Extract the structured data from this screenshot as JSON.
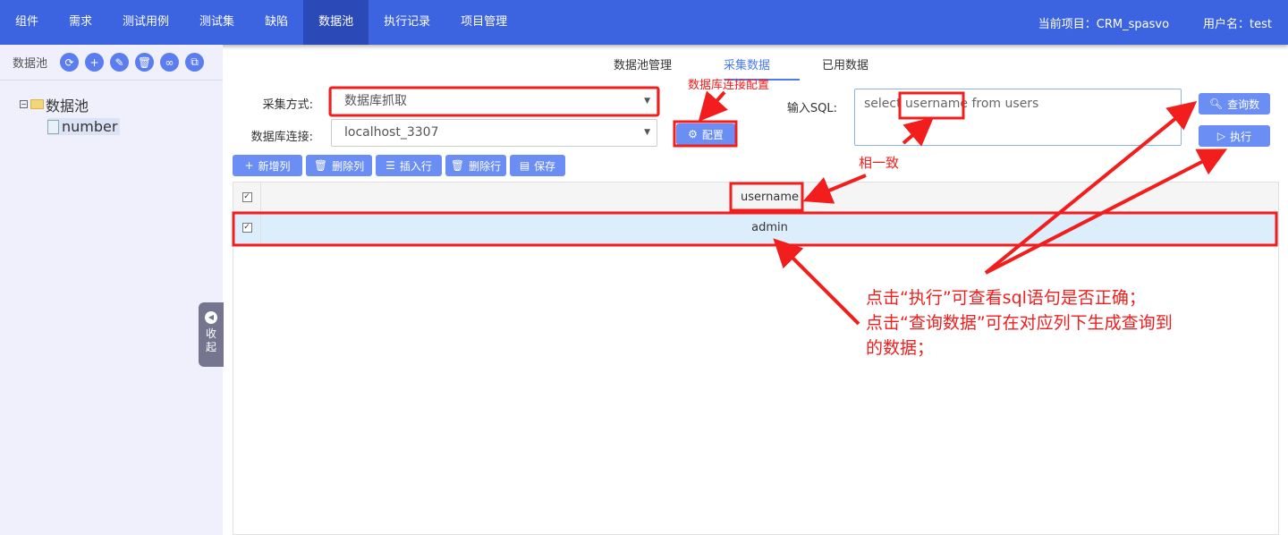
{
  "nav": {
    "items": [
      "组件",
      "需求",
      "测试用例",
      "测试集",
      "缺陷",
      "数据池",
      "执行记录",
      "项目管理"
    ],
    "active": 5,
    "project": "当前项目：CRM_spasvo",
    "user": "用户名：test"
  },
  "sidebar": {
    "title": "数据池",
    "icons": [
      "refresh-icon",
      "plus-icon",
      "edit-icon",
      "trash-icon",
      "link-icon",
      "copy-icon"
    ],
    "tree_root": "数据池",
    "tree_leaf": "number",
    "collapse": "收起"
  },
  "tabs": [
    "数据池管理",
    "采集数据",
    "已用数据"
  ],
  "active_tab": 1,
  "form": {
    "method_label": "采集方式:",
    "method_value": "数据库抓取",
    "db_label": "数据库连接:",
    "db_value": "localhost_3307",
    "config_button": "配置",
    "sql_label": "输入SQL:",
    "sql_value": "select username from users",
    "query_button": "查询数",
    "exec_button": "执行"
  },
  "toolbar": {
    "add_col": "新增列",
    "del_col": "删除列",
    "insert_row": "插入行",
    "del_row": "删除行",
    "save": "保存"
  },
  "grid": {
    "header": "username",
    "rows": [
      "admin"
    ]
  },
  "annotations": {
    "config": "数据库连接配置",
    "consistent": "相一致",
    "note1": "点击“执行”可查看sql语句是否正确；",
    "note2": "点击“查询数据”可在对应列下生成查询到",
    "note3": "的数据；",
    "color": "#f21d1d"
  }
}
